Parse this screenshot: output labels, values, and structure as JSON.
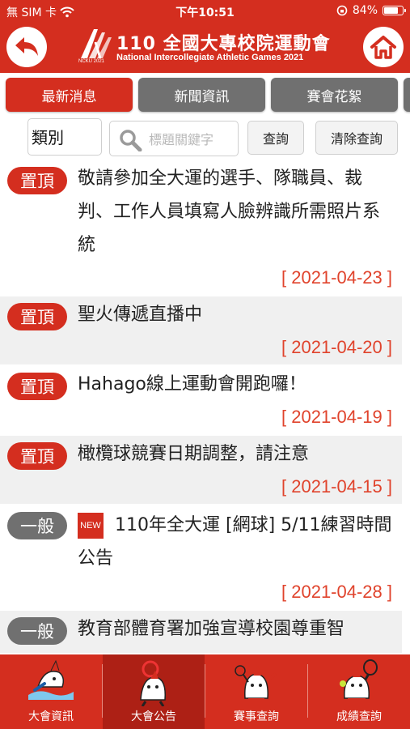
{
  "status_bar": {
    "carrier": "無 SIM 卡",
    "time": "下午10:51",
    "battery": "84%",
    "battery_level": 0.84
  },
  "header": {
    "logo_title": "110 全國大專校院運動會",
    "logo_subtitle": "National Intercollegiate Athletic Games 2021",
    "logo_small": "NCKU 2021"
  },
  "tabs": [
    {
      "label": "最新消息",
      "active": true
    },
    {
      "label": "新聞資訊",
      "active": false
    },
    {
      "label": "賽會花絮",
      "active": false
    }
  ],
  "filter": {
    "category_value": "類別",
    "search_placeholder": "標題關鍵字",
    "search_button": "查詢",
    "clear_button": "清除查詢"
  },
  "news": [
    {
      "badge": "置頂",
      "type": "top",
      "title": "敬請參加全大運的選手、隊職員、裁判、工作人員填寫人臉辨識所需照片系統",
      "date": "[ 2021-04-23 ]",
      "is_new": false
    },
    {
      "badge": "置頂",
      "type": "top",
      "title": "聖火傳遞直播中",
      "date": "[ 2021-04-20 ]",
      "is_new": false
    },
    {
      "badge": "置頂",
      "type": "top",
      "title": "Hahago線上運動會開跑囉！",
      "date": "[ 2021-04-19 ]",
      "is_new": false
    },
    {
      "badge": "置頂",
      "type": "top",
      "title": "橄欖球競賽日期調整，請注意",
      "date": "[ 2021-04-15 ]",
      "is_new": false
    },
    {
      "badge": "一般",
      "type": "normal",
      "new_tag": "NEW",
      "title": "110年全大運 [網球] 5/11練習時間公告",
      "date": "[ 2021-04-28 ]",
      "is_new": true
    },
    {
      "badge": "一般",
      "type": "normal",
      "title": "教育部體育署加強宣導校園尊重智",
      "date": "",
      "is_new": false
    }
  ],
  "bottom_nav": [
    {
      "label": "大會資訊",
      "icon": "mascot-swimming-icon",
      "active": false
    },
    {
      "label": "大會公告",
      "icon": "mascot-megaphone-icon",
      "active": true
    },
    {
      "label": "賽事查詢",
      "icon": "mascot-badminton-icon",
      "active": false
    },
    {
      "label": "成績查詢",
      "icon": "mascot-tennis-icon",
      "active": false
    }
  ],
  "colors": {
    "brand_red": "#d42e1f",
    "gray_tab": "#707070",
    "date_red": "#e0432c",
    "row_gray": "#f0f0f0"
  }
}
